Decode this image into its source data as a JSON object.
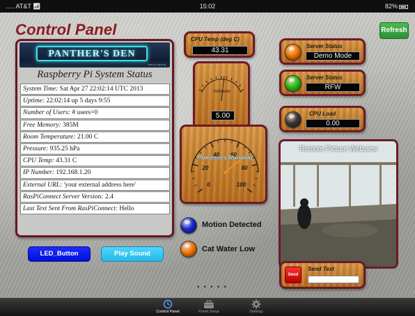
{
  "status_bar": {
    "carrier": "..... AT&T",
    "wifi_icon": "wifi-icon",
    "time": "15:02",
    "battery": "82%"
  },
  "header": {
    "title": "Control Panel",
    "refresh_label": "Refresh"
  },
  "status_panel": {
    "banner_text": "PANTHER'S DEN",
    "banner_caption": "interior lighting",
    "title": "Raspberry Pi System Status",
    "rows": [
      {
        "label": "System Time:",
        "value": "Sat Apr 27 22:02:14 UTC 2013"
      },
      {
        "label": "Uptime:",
        "value": "22:02:14 up 5 days 9:55"
      },
      {
        "label": "Number of Users:",
        "value": "# users=0"
      },
      {
        "label": "Free Memory:",
        "value": "385M"
      },
      {
        "label": "Room Temperature:",
        "value": "21.00 C"
      },
      {
        "label": "Pressure:",
        "value": "935.25 hPa"
      },
      {
        "label": "CPU Temp:",
        "value": "43.31 C"
      },
      {
        "label": "IP Number:",
        "value": "192.168.1.20"
      },
      {
        "label": "External URL:",
        "value": "'your external address here'"
      },
      {
        "label": "RasPiConnect Server Version:",
        "value": "2.4"
      },
      {
        "label": "Last Text Sent From RasPiConnect:",
        "value": "Hello"
      }
    ]
  },
  "cpu_temp": {
    "label": "CPU Temp (deg C)",
    "value": "43.31"
  },
  "voltmeter": {
    "label": "Voltmeter",
    "value": "5.00",
    "level": 0.55
  },
  "processes_gauge": {
    "label": "Processes Running",
    "ticks": [
      "0",
      "20",
      "40",
      "60",
      "80",
      "100"
    ],
    "value": 70
  },
  "server_status_1": {
    "label": "Server Status",
    "value": "Demo Mode",
    "led_color": "#ff7a00"
  },
  "server_status_2": {
    "label": "Server Status",
    "value": "RFW",
    "led_color": "#26c81e"
  },
  "cpu_load": {
    "label": "CPU Load",
    "value": "0.00",
    "led_color": "#3a3a3a"
  },
  "buttons": {
    "led": "LED_Button",
    "sound": "Play Sound"
  },
  "indicators": {
    "motion": {
      "label": "Motion Detected",
      "color": "#1a2bd6"
    },
    "water": {
      "label": "Cat Water Low",
      "color": "#ff7a00"
    }
  },
  "webview": {
    "label": "Remote Picture Webview"
  },
  "send_text": {
    "label": "Send Text",
    "button": "Send",
    "placeholder": ""
  },
  "page_dots": "• • • • •",
  "tabbar": {
    "items": [
      {
        "label": "Control Panel",
        "icon": "clock-icon",
        "active": true
      },
      {
        "label": "Panel Setup",
        "icon": "toolbox-icon",
        "active": false
      },
      {
        "label": "Settings",
        "icon": "gear-icon",
        "active": false
      }
    ]
  }
}
